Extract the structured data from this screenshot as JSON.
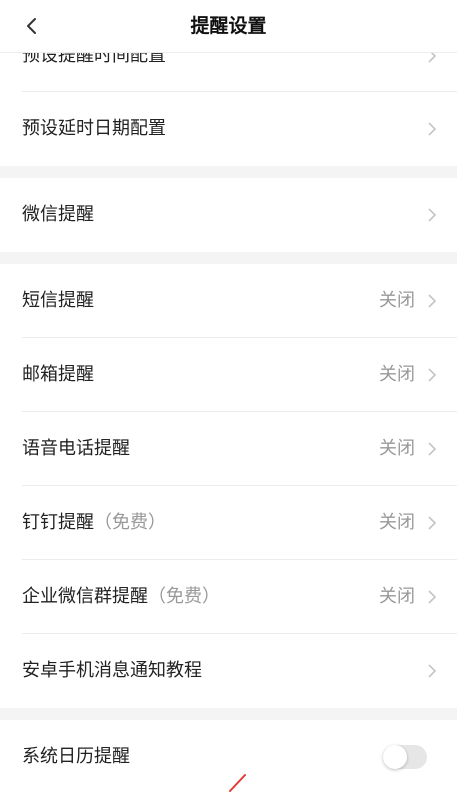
{
  "header": {
    "title": "提醒设置",
    "back_icon": "chevron-left-icon"
  },
  "rows": [
    {
      "label": "预设提醒时间配置",
      "suffix": "",
      "value": ""
    },
    {
      "label": "预设延时日期配置",
      "suffix": "",
      "value": ""
    },
    {
      "label": "微信提醒",
      "suffix": "",
      "value": ""
    },
    {
      "label": "短信提醒",
      "suffix": "",
      "value": "关闭"
    },
    {
      "label": "邮箱提醒",
      "suffix": "",
      "value": "关闭"
    },
    {
      "label": "语音电话提醒",
      "suffix": "",
      "value": "关闭"
    },
    {
      "label": "钉钉提醒",
      "suffix": "（免费）",
      "value": "关闭"
    },
    {
      "label": "企业微信群提醒",
      "suffix": "（免费）",
      "value": "关闭"
    },
    {
      "label": "安卓手机消息通知教程",
      "suffix": "",
      "value": ""
    },
    {
      "label": "系统日历提醒",
      "suffix": "",
      "value": "",
      "toggle": false
    }
  ],
  "colors": {
    "text": "#222222",
    "muted": "#999999",
    "divider": "#ececec",
    "section_gap": "#f4f4f4",
    "toggle_off": "#e6e6e6",
    "accent_mark": "#e53935"
  }
}
